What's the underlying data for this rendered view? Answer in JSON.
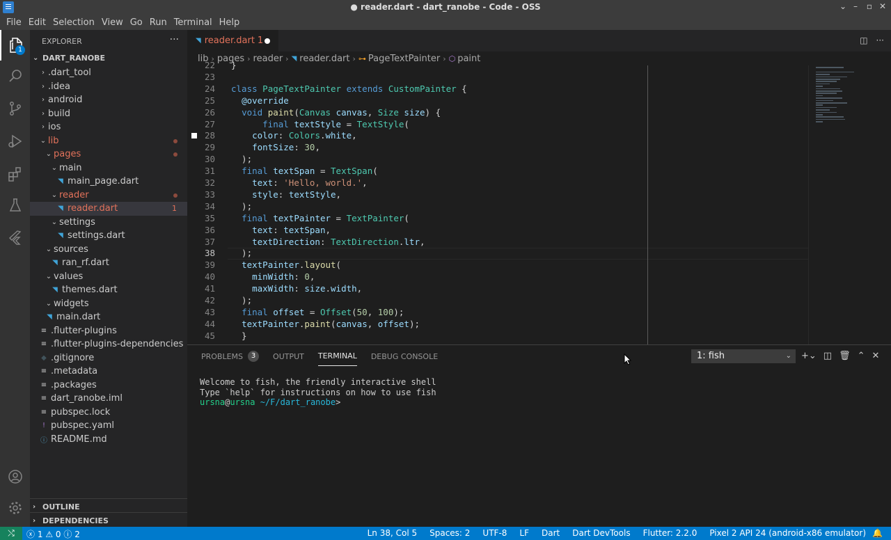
{
  "window": {
    "title": "● reader.dart - dart_ranobe - Code - OSS"
  },
  "menu": [
    "File",
    "Edit",
    "Selection",
    "View",
    "Go",
    "Run",
    "Terminal",
    "Help"
  ],
  "activity": {
    "explorer_badge": "1"
  },
  "explorer": {
    "title": "EXPLORER",
    "more": "···",
    "root": "DART_RANOBE",
    "tree": [
      {
        "label": ".dart_tool",
        "depth": 1,
        "type": "folder-closed"
      },
      {
        "label": ".idea",
        "depth": 1,
        "type": "folder-closed"
      },
      {
        "label": "android",
        "depth": 1,
        "type": "folder-closed"
      },
      {
        "label": "build",
        "depth": 1,
        "type": "folder-closed"
      },
      {
        "label": "ios",
        "depth": 1,
        "type": "folder-closed"
      },
      {
        "label": "lib",
        "depth": 1,
        "type": "folder-open",
        "modified": true
      },
      {
        "label": "pages",
        "depth": 2,
        "type": "folder-open",
        "modified": true
      },
      {
        "label": "main",
        "depth": 3,
        "type": "folder-open"
      },
      {
        "label": "main_page.dart",
        "depth": 4,
        "type": "dart"
      },
      {
        "label": "reader",
        "depth": 3,
        "type": "folder-open",
        "modified": true
      },
      {
        "label": "reader.dart",
        "depth": 4,
        "type": "dart",
        "modified": true,
        "selected": true,
        "count": "1"
      },
      {
        "label": "settings",
        "depth": 3,
        "type": "folder-open"
      },
      {
        "label": "settings.dart",
        "depth": 4,
        "type": "dart"
      },
      {
        "label": "sources",
        "depth": 2,
        "type": "folder-open"
      },
      {
        "label": "ran_rf.dart",
        "depth": 3,
        "type": "dart"
      },
      {
        "label": "values",
        "depth": 2,
        "type": "folder-open"
      },
      {
        "label": "themes.dart",
        "depth": 3,
        "type": "dart"
      },
      {
        "label": "widgets",
        "depth": 2,
        "type": "folder-open"
      },
      {
        "label": "main.dart",
        "depth": 2,
        "type": "dart"
      },
      {
        "label": ".flutter-plugins",
        "depth": 1,
        "type": "lines"
      },
      {
        "label": ".flutter-plugins-dependencies",
        "depth": 1,
        "type": "lines"
      },
      {
        "label": ".gitignore",
        "depth": 1,
        "type": "git"
      },
      {
        "label": ".metadata",
        "depth": 1,
        "type": "lines"
      },
      {
        "label": ".packages",
        "depth": 1,
        "type": "lines"
      },
      {
        "label": "dart_ranobe.iml",
        "depth": 1,
        "type": "lines"
      },
      {
        "label": "pubspec.lock",
        "depth": 1,
        "type": "lines"
      },
      {
        "label": "pubspec.yaml",
        "depth": 1,
        "type": "yaml"
      },
      {
        "label": "README.md",
        "depth": 1,
        "type": "info"
      }
    ],
    "outline": "OUTLINE",
    "dependencies": "DEPENDENCIES"
  },
  "editor": {
    "tab": {
      "label": "reader.dart",
      "count": "1"
    },
    "breadcrumbs": [
      "lib",
      "pages",
      "reader",
      "reader.dart",
      "PageTextPainter",
      "paint"
    ],
    "current_line": 38,
    "lines": [
      {
        "n": "22",
        "html": "}"
      },
      {
        "n": "23",
        "html": ""
      },
      {
        "n": "24",
        "html": "<span class='k'>class</span> <span class='t'>PageTextPainter</span> <span class='k'>extends</span> <span class='t'>CustomPainter</span> {"
      },
      {
        "n": "25",
        "html": "  <span class='v'>@override</span>"
      },
      {
        "n": "26",
        "html": "  <span class='k'>void</span> <span class='f'>paint</span>(<span class='t'>Canvas</span> <span class='v'>canvas</span>, <span class='t'>Size</span> <span class='v'>size</span>) {"
      },
      {
        "n": "27",
        "html": "      <span class='k'>final</span> <span class='v'>textStyle</span> = <span class='t'>TextStyle</span>("
      },
      {
        "n": "28",
        "html": "    <span class='v'>color</span>: <span class='t'>Colors</span>.<span class='v'>white</span>,"
      },
      {
        "n": "29",
        "html": "    <span class='v'>fontSize</span>: <span class='n'>30</span>,"
      },
      {
        "n": "30",
        "html": "  );"
      },
      {
        "n": "31",
        "html": "  <span class='k'>final</span> <span class='v'>textSpan</span> = <span class='t'>TextSpan</span>("
      },
      {
        "n": "32",
        "html": "    <span class='v'>text</span>: <span class='s'>'Hello, world.'</span>,"
      },
      {
        "n": "33",
        "html": "    <span class='v'>style</span>: <span class='v'>textStyle</span>,"
      },
      {
        "n": "34",
        "html": "  );"
      },
      {
        "n": "35",
        "html": "  <span class='k'>final</span> <span class='v'>textPainter</span> = <span class='t'>TextPainter</span>("
      },
      {
        "n": "36",
        "html": "    <span class='v'>text</span>: <span class='v'>textSpan</span>,"
      },
      {
        "n": "37",
        "html": "    <span class='v'>textDirection</span>: <span class='t'>TextDirection</span>.<span class='v'>ltr</span>,"
      },
      {
        "n": "38",
        "html": "  );"
      },
      {
        "n": "39",
        "html": "  <span class='v'>textPainter</span>.<span class='f'>layout</span>("
      },
      {
        "n": "40",
        "html": "    <span class='v'>minWidth</span>: <span class='n'>0</span>,"
      },
      {
        "n": "41",
        "html": "    <span class='v'>maxWidth</span>: <span class='v'>size</span>.<span class='v'>width</span>,"
      },
      {
        "n": "42",
        "html": "  );"
      },
      {
        "n": "43",
        "html": "  <span class='k'>final</span> <span class='v'>offset</span> = <span class='t'>Offset</span>(<span class='n'>50</span>, <span class='n'>100</span>);"
      },
      {
        "n": "44",
        "html": "  <span class='v'>textPainter</span>.<span class='f'>paint</span>(<span class='v'>canvas</span>, <span class='v'>offset</span>);"
      },
      {
        "n": "45",
        "html": "  }"
      }
    ]
  },
  "panel": {
    "tabs": [
      {
        "label": "PROBLEMS",
        "badge": "3"
      },
      {
        "label": "OUTPUT"
      },
      {
        "label": "TERMINAL",
        "active": true
      },
      {
        "label": "DEBUG CONSOLE"
      }
    ],
    "terminal_select": "1: fish",
    "terminal_lines": [
      "Welcome to fish, the friendly interactive shell",
      "Type `help` for instructions on how to use fish"
    ],
    "prompt": {
      "user": "ursna",
      "at": "@",
      "host": "ursna",
      "path": " ~/F/dart_ranobe",
      "symbol": ">"
    }
  },
  "status": {
    "errors": "1",
    "warnings": "0",
    "infos": "2",
    "items": [
      "Ln 38, Col 5",
      "Spaces: 2",
      "UTF-8",
      "LF",
      "Dart",
      "Dart DevTools",
      "Flutter: 2.2.0",
      "Pixel 2 API 24 (android-x86 emulator)"
    ]
  },
  "colors": {
    "accent": "#007acc",
    "modified": "#e2725b",
    "dart": "#40a4d8"
  }
}
